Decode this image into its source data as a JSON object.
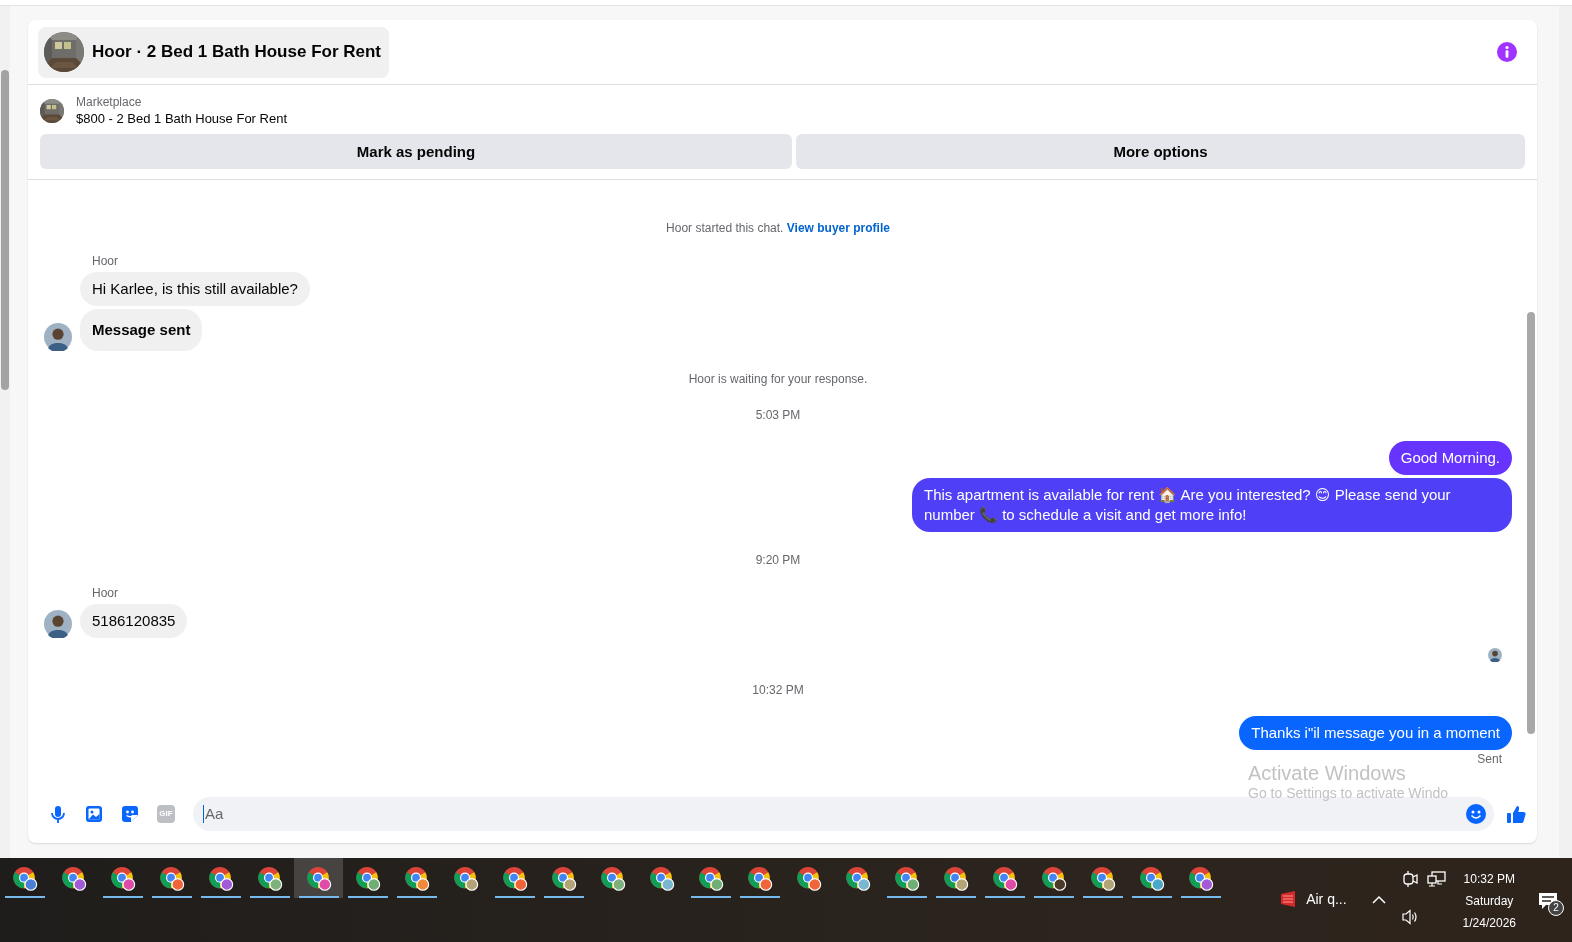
{
  "conversation": {
    "title": "Hoor · 2 Bed 1 Bath House For Rent",
    "listing": {
      "source": "Marketplace",
      "title": "$800 - 2 Bed 1 Bath House For Rent"
    },
    "actions": [
      "Mark as pending",
      "More options"
    ]
  },
  "messages": [
    {
      "kind": "system",
      "text": "Hoor started this chat.",
      "link": "View buyer profile"
    },
    {
      "kind": "incoming",
      "sender": "Hoor",
      "text": "Hi Karlee, is this still available?",
      "avatar": false,
      "bold": false
    },
    {
      "kind": "incoming",
      "text": "Message sent",
      "avatar": true,
      "bold": true
    },
    {
      "kind": "system",
      "text": "Hoor is waiting for your response."
    },
    {
      "kind": "time",
      "text": "5:03 PM"
    },
    {
      "kind": "outgoing",
      "text": "Good Morning.",
      "color": "#6633ff"
    },
    {
      "kind": "outgoing",
      "text": "This apartment is available for rent 🏠 Are you interested? 😊 Please send your number 📞 to schedule a visit and get more info!",
      "color": "#4f3ff6"
    },
    {
      "kind": "time",
      "text": "9:20 PM"
    },
    {
      "kind": "incoming",
      "sender": "Hoor",
      "text": "5186120835",
      "avatar": true,
      "bold": false
    },
    {
      "kind": "seen"
    },
    {
      "kind": "time",
      "text": "10:32 PM"
    },
    {
      "kind": "outgoing",
      "text": "Thanks i\"il message you in a moment",
      "color": "#0866ff",
      "status": "Sent"
    }
  ],
  "composer": {
    "gif": "GIF",
    "placeholder": "Aa"
  },
  "os_notice": {
    "title": "Activate Windows",
    "hint": "Go to Settings to activate Windo"
  },
  "taskbar": {
    "apps": [
      {
        "color": "#4a7fd8",
        "running": true,
        "selected": false
      },
      {
        "color": "#a35ad8",
        "running": false,
        "selected": false
      },
      {
        "color": "#e04aa8",
        "running": true,
        "selected": false
      },
      {
        "color": "#f0643a",
        "running": true,
        "selected": false
      },
      {
        "color": "#a35ad8",
        "running": true,
        "selected": false
      },
      {
        "color": "#7db07d",
        "running": true,
        "selected": false
      },
      {
        "color": "#e04aa8",
        "running": true,
        "selected": true
      },
      {
        "color": "#6fae74",
        "running": true,
        "selected": false
      },
      {
        "color": "#f08a3a",
        "running": true,
        "selected": false
      },
      {
        "color": "#b3a478",
        "running": false,
        "selected": false
      },
      {
        "color": "#f0643a",
        "running": true,
        "selected": false
      },
      {
        "color": "#b3a478",
        "running": true,
        "selected": false
      },
      {
        "color": "#7db07d",
        "running": false,
        "selected": false
      },
      {
        "color": "#7ab6d0",
        "running": false,
        "selected": false
      },
      {
        "color": "#6fae74",
        "running": true,
        "selected": false
      },
      {
        "color": "#f0643a",
        "running": true,
        "selected": false
      },
      {
        "color": "#f0643a",
        "running": false,
        "selected": false
      },
      {
        "color": "#7ab6d0",
        "running": false,
        "selected": false
      },
      {
        "color": "#6fae74",
        "running": true,
        "selected": false
      },
      {
        "color": "#b3a478",
        "running": true,
        "selected": false
      },
      {
        "color": "#e04aa8",
        "running": true,
        "selected": false
      },
      {
        "color": "#4a3a2a",
        "running": true,
        "selected": false
      },
      {
        "color": "#b3a478",
        "running": true,
        "selected": false
      },
      {
        "color": "#4aa8c8",
        "running": true,
        "selected": false
      },
      {
        "color": "#a35ad8",
        "running": true,
        "selected": false
      }
    ],
    "weather": "Air q...",
    "clock": {
      "time": "10:32 PM",
      "day": "Saturday",
      "date": "1/24/2026"
    },
    "notifications": "2"
  }
}
